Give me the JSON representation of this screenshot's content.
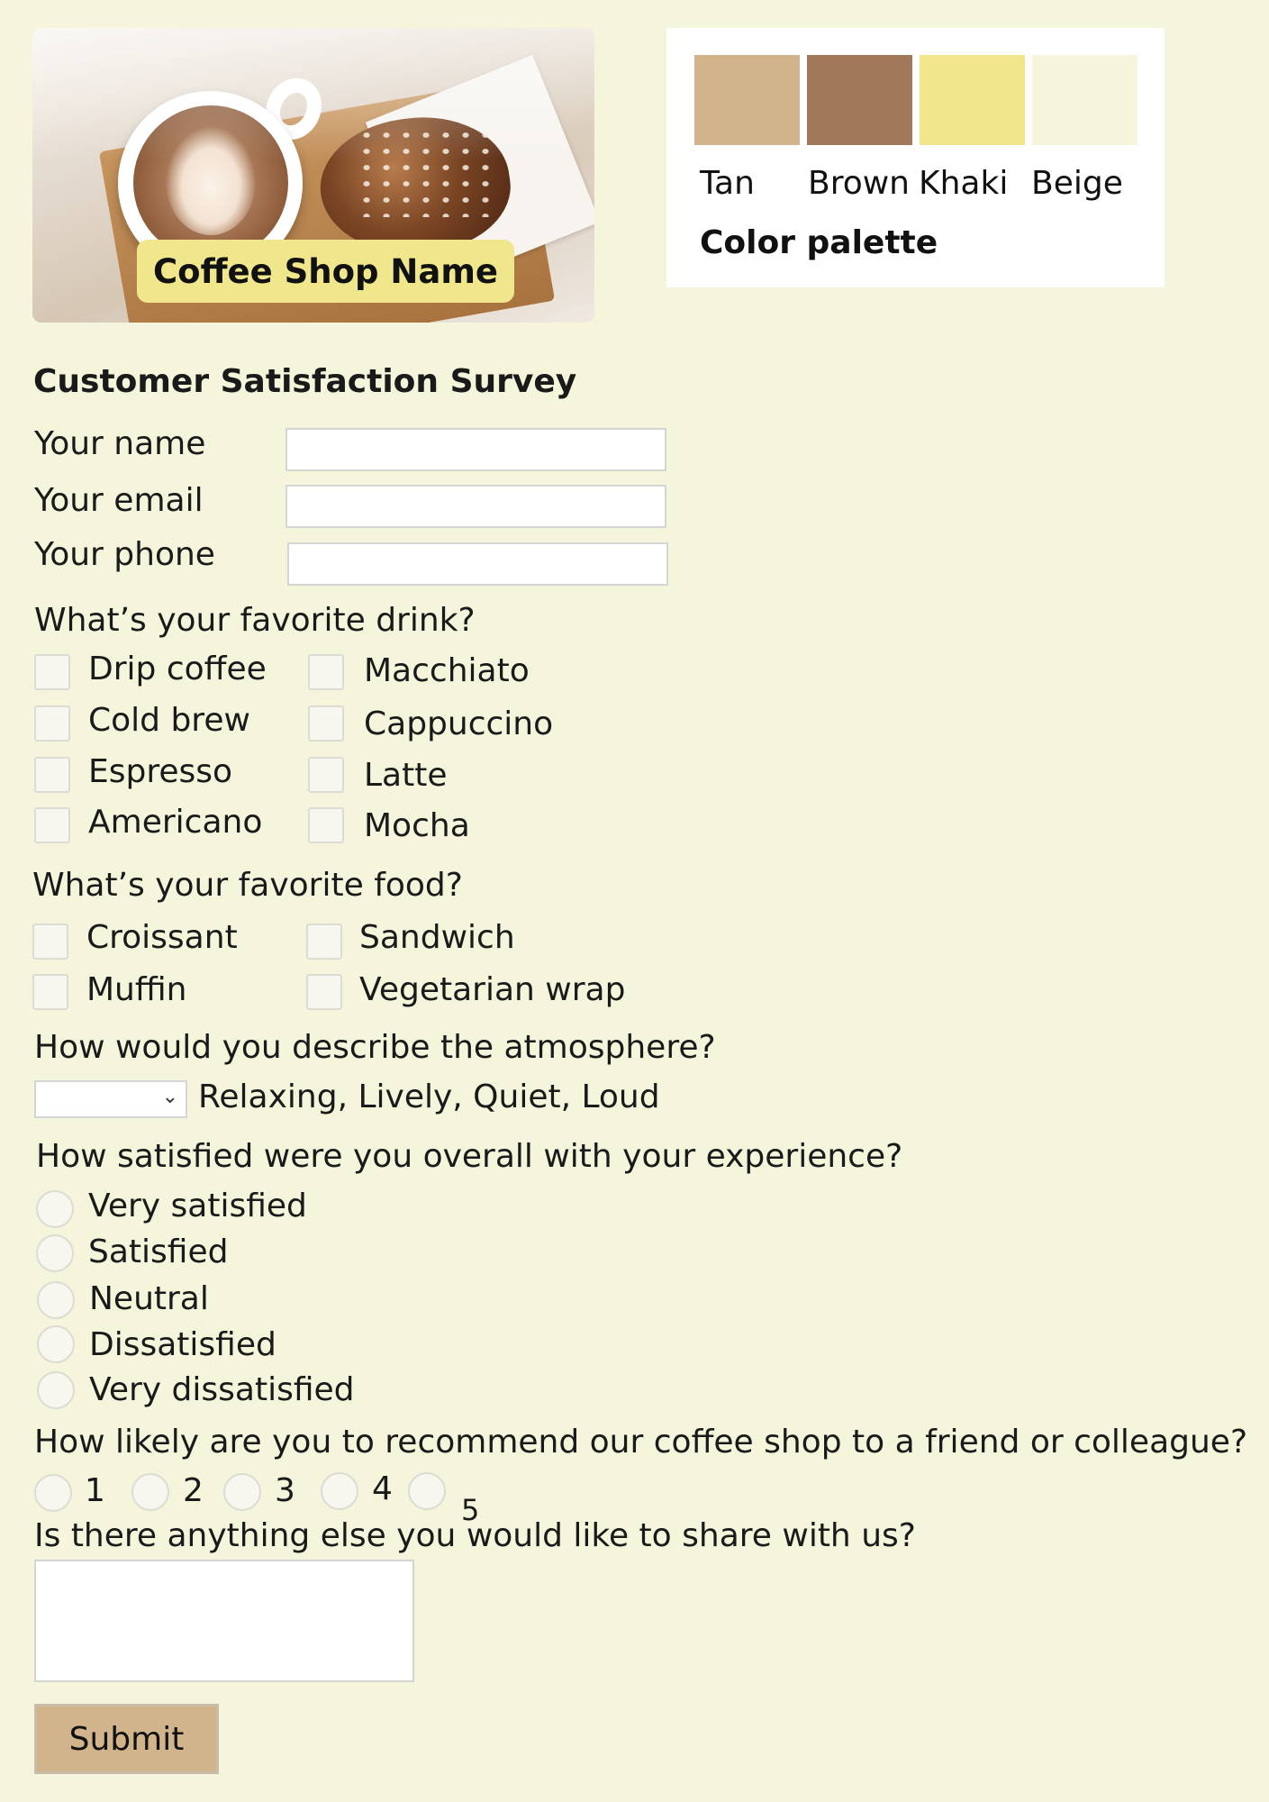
{
  "hero": {
    "shop_name": "Coffee Shop Name"
  },
  "palette": {
    "title": "Color palette",
    "swatches": [
      {
        "name": "Tan",
        "color": "#D2B48C"
      },
      {
        "name": "Brown",
        "color": "#A0785A"
      },
      {
        "name": "Khaki",
        "color": "#F0E68C"
      },
      {
        "name": "Beige",
        "color": "#F5F5DC"
      }
    ]
  },
  "survey": {
    "title": "Customer Satisfaction Survey",
    "fields": {
      "name_label": "Your name",
      "email_label": "Your email",
      "phone_label": "Your phone"
    },
    "drink": {
      "question": "What’s your favorite drink?",
      "options": [
        "Drip coffee",
        "Cold brew",
        "Espresso",
        "Americano",
        "Macchiato",
        "Cappuccino",
        "Latte",
        "Mocha"
      ]
    },
    "food": {
      "question": "What’s your favorite food?",
      "options": [
        "Croissant",
        "Muffin",
        "Sandwich",
        "Vegetarian wrap"
      ]
    },
    "atmosphere": {
      "question": "How would you describe the atmosphere?",
      "options_text": "Relaxing, Lively, Quiet, Loud"
    },
    "satisfaction": {
      "question": "How satisfied were you overall with your experience?",
      "options": [
        "Very satisfied",
        "Satisfied",
        "Neutral",
        "Dissatisfied",
        "Very dissatisfied"
      ]
    },
    "recommend": {
      "question": "How likely are you to recommend our coffee shop to a friend or colleague?",
      "options": [
        "1",
        "2",
        "3",
        "4",
        "5"
      ]
    },
    "comments": {
      "question": "Is there anything else you would like to share with us?"
    },
    "submit_label": "Submit"
  },
  "colors": {
    "background": "#F5F5DC",
    "accent": "#F0E68C",
    "button": "#D2B48C"
  }
}
